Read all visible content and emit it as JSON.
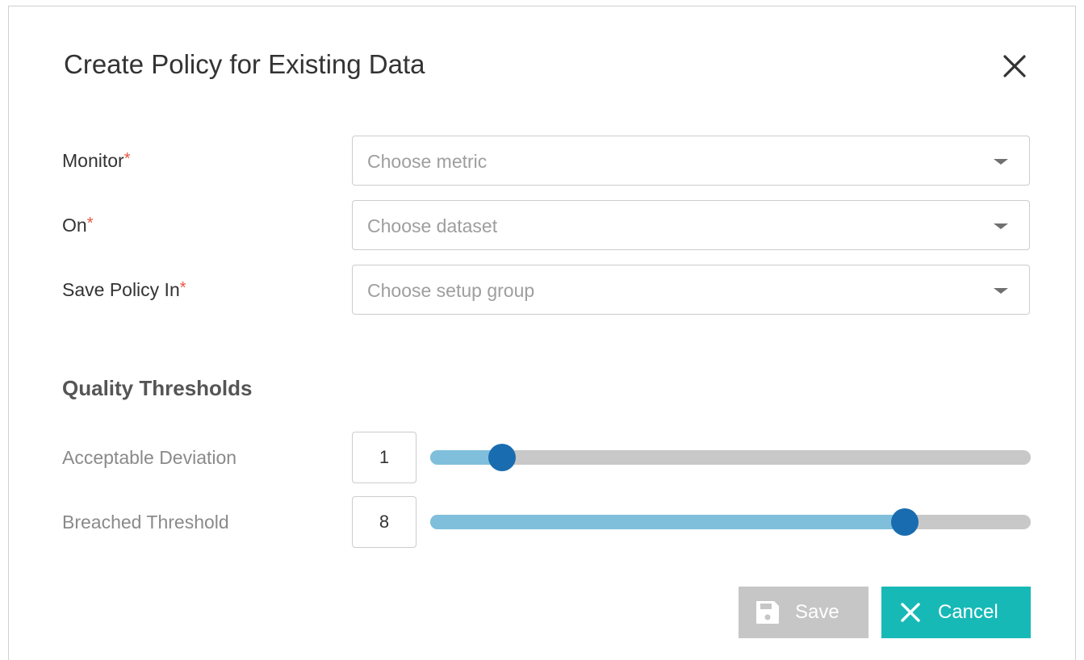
{
  "dialog": {
    "title": "Create Policy for Existing Data",
    "close_icon": "close-icon"
  },
  "fields": {
    "monitor": {
      "label": "Monitor",
      "required_mark": "*",
      "placeholder": "Choose metric"
    },
    "on": {
      "label": "On",
      "required_mark": "*",
      "placeholder": "Choose dataset"
    },
    "save_in": {
      "label": "Save Policy In",
      "required_mark": "*",
      "placeholder": "Choose setup group"
    }
  },
  "thresholds": {
    "section_title": "Quality Thresholds",
    "acceptable": {
      "label": "Acceptable Deviation",
      "value": "1",
      "level_fraction": 0.12
    },
    "breached": {
      "label": "Breached Threshold",
      "value": "8",
      "level_fraction": 0.79
    }
  },
  "buttons": {
    "save_label": "Save",
    "save_icon": "save-icon",
    "cancel_label": "Cancel",
    "cancel_icon": "close-icon"
  },
  "colors": {
    "required": "#e8553f",
    "slider_fill": "#7fbfdb",
    "slider_thumb": "#1a6cb0",
    "cancel_button": "#17b9b7",
    "save_button_disabled": "#c6c6c6"
  }
}
